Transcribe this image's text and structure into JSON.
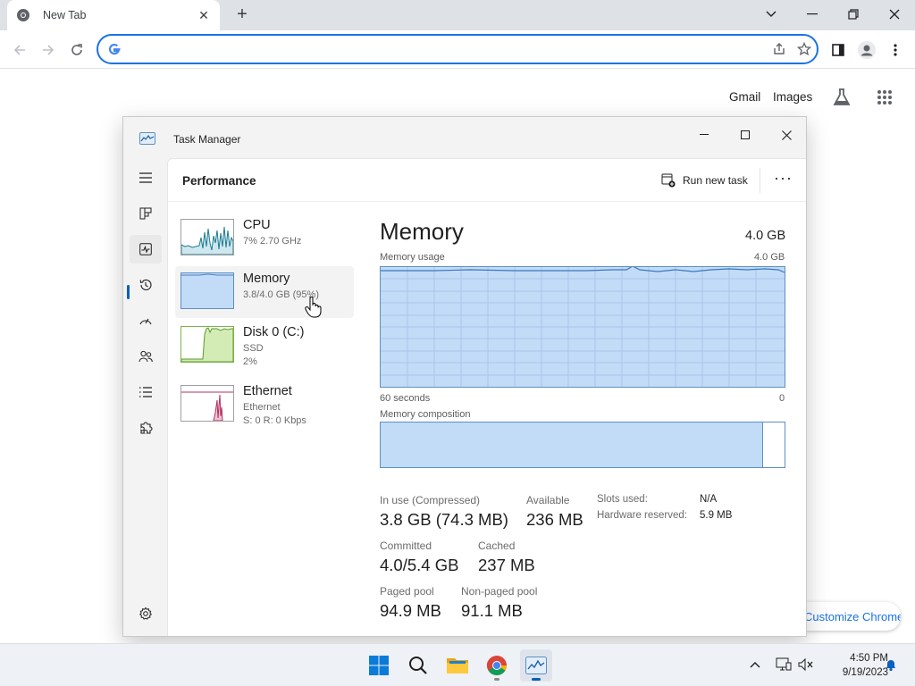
{
  "browser": {
    "tab_title": "New Tab",
    "omnibox_value": "",
    "ntp_links": {
      "gmail": "Gmail",
      "images": "Images"
    },
    "customize_label": "Customize Chrome"
  },
  "taskmanager": {
    "title": "Task Manager",
    "page_title": "Performance",
    "run_new_task": "Run new task",
    "more": "···",
    "resources": [
      {
        "name": "CPU",
        "line1": "7% 2.70 GHz",
        "line2": ""
      },
      {
        "name": "Memory",
        "line1": "3.8/4.0 GB (95%)",
        "line2": ""
      },
      {
        "name": "Disk 0 (C:)",
        "line1": "SSD",
        "line2": "2%"
      },
      {
        "name": "Ethernet",
        "line1": "Ethernet",
        "line2": "S: 0 R: 0 Kbps"
      }
    ],
    "memory": {
      "title": "Memory",
      "total": "4.0 GB",
      "usage_label": "Memory usage",
      "usage_max": "4.0 GB",
      "time_span": "60 seconds",
      "time_zero": "0",
      "usage_fraction": 0.95,
      "composition_label": "Memory composition",
      "stats": {
        "in_use_label": "In use (Compressed)",
        "in_use_value": "3.8 GB (74.3 MB)",
        "available_label": "Available",
        "available_value": "236 MB",
        "committed_label": "Committed",
        "committed_value": "4.0/5.4 GB",
        "cached_label": "Cached",
        "cached_value": "237 MB",
        "paged_label": "Paged pool",
        "paged_value": "94.9 MB",
        "nonpaged_label": "Non-paged pool",
        "nonpaged_value": "91.1 MB",
        "slots_label": "Slots used:",
        "slots_value": "N/A",
        "hw_reserved_label": "Hardware reserved:",
        "hw_reserved_value": "5.9 MB"
      }
    }
  },
  "taskbar": {
    "time": "4:50 PM",
    "date": "9/19/2023"
  },
  "colors": {
    "accent": "#005fb8",
    "memory_fill": "#c2dbf7",
    "memory_line": "#5d8fc4",
    "chrome_blue": "#1a73e8"
  }
}
